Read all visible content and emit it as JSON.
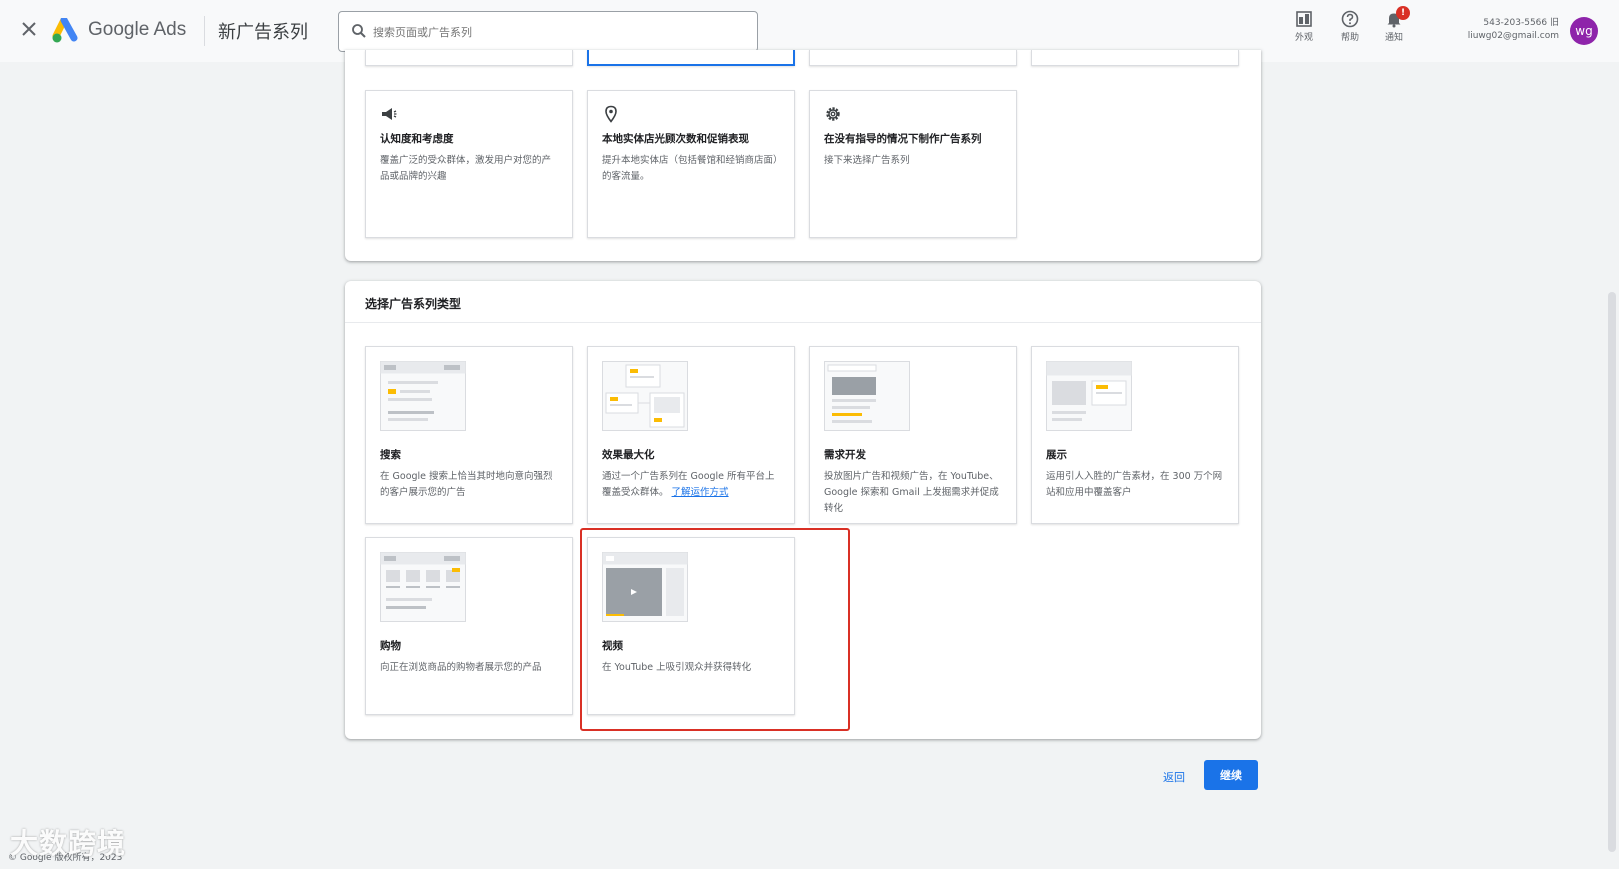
{
  "header": {
    "brand": "Google Ads",
    "page_title": "新广告系列",
    "search_placeholder": "搜索页面或广告系列",
    "appearance_label": "外观",
    "help_label": "帮助",
    "notifications_label": "通知",
    "notification_badge": "!",
    "account_phone": "543-203-5566 旧",
    "account_email": "liuwg02@gmail.com",
    "avatar_initials": "wg"
  },
  "goals": [
    {
      "title": "认知度和考虑度",
      "desc": "覆盖广泛的受众群体，激发用户对您的产品或品牌的兴趣",
      "icon": "megaphone-icon"
    },
    {
      "title": "本地实体店光顾次数和促销表现",
      "desc": "提升本地实体店（包括餐馆和经销商店面）的客流量。",
      "icon": "location-pin-icon"
    },
    {
      "title": "在没有指导的情况下制作广告系列",
      "desc": "接下来选择广告系列",
      "icon": "gear-icon"
    }
  ],
  "campaign_types": {
    "heading": "选择广告系列类型",
    "items": [
      {
        "title": "搜索",
        "desc": "在 Google 搜索上恰当其时地向意向强烈的客户展示您的广告"
      },
      {
        "title": "效果最大化",
        "desc": "通过一个广告系列在 Google 所有平台上覆盖受众群体。",
        "link": "了解运作方式"
      },
      {
        "title": "需求开发",
        "desc": "投放图片广告和视频广告，在 YouTube、Google 探索和 Gmail 上发掘需求并促成转化"
      },
      {
        "title": "展示",
        "desc": "运用引人入胜的广告素材，在 300 万个网站和应用中覆盖客户"
      },
      {
        "title": "购物",
        "desc": "向正在浏览商品的购物者展示您的产品"
      },
      {
        "title": "视频",
        "desc": "在 YouTube 上吸引观众并获得转化"
      }
    ]
  },
  "actions": {
    "back": "返回",
    "continue": "继续"
  },
  "watermark": "大数跨境",
  "copyright": "© Google 版权所有，2023"
}
